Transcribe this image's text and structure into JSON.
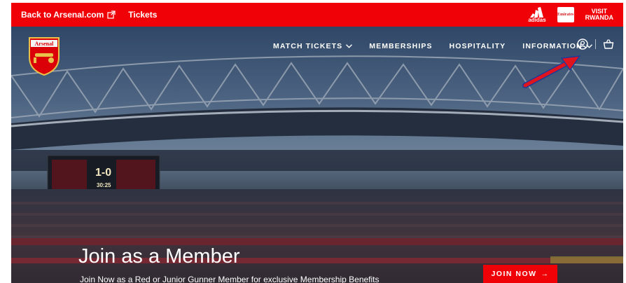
{
  "topbar": {
    "back_label": "Back to Arsenal.com",
    "tickets_label": "Tickets",
    "adidas_label": "adidas",
    "emirates_label": "Emirates",
    "visit_label": "VISIT",
    "rwanda_label": "RWANDA"
  },
  "brand": {
    "crest_text": "Arsenal"
  },
  "nav": {
    "items": [
      {
        "label": "MATCH TICKETS",
        "dropdown": true
      },
      {
        "label": "MEMBERSHIPS",
        "dropdown": false
      },
      {
        "label": "HOSPITALITY",
        "dropdown": false
      },
      {
        "label": "INFORMATION",
        "dropdown": true
      }
    ],
    "icons": [
      "user-icon",
      "basket-icon"
    ]
  },
  "scoreboard": {
    "score": "1-0",
    "clock": "30:25"
  },
  "hero": {
    "title": "Join as a Member",
    "subtitle": "Join Now as a Red or Junior Gunner Member for exclusive Membership Benefits",
    "cta_label": "JOIN NOW",
    "cta_arrow": "→"
  },
  "colors": {
    "brand_red": "#ef0107",
    "annotation_arrow": "#e0141e",
    "annotation_outline": "#1d3a9a"
  }
}
